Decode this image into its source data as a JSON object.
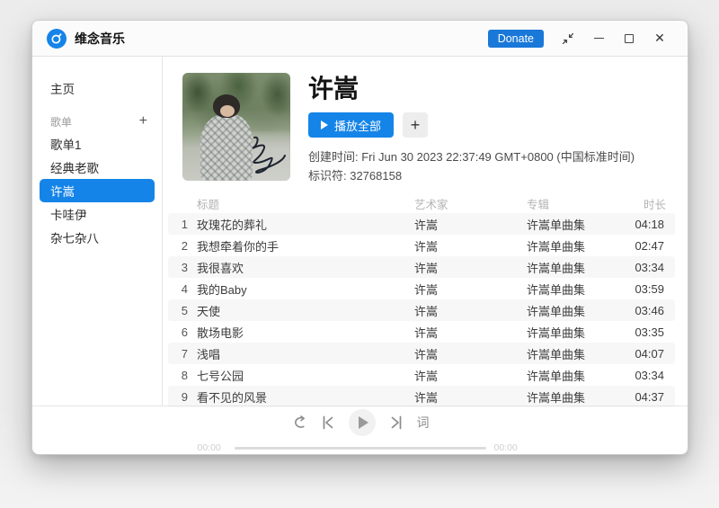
{
  "window": {
    "title": "维念音乐",
    "accent_color": "#1584e8",
    "titlebar": {
      "donate_label": "Donate",
      "close_glyph": "✕"
    }
  },
  "sidebar": {
    "home_label": "主页",
    "section_label": "歌单",
    "add_glyph": "+",
    "playlists": [
      "歌单1",
      "经典老歌",
      "许嵩",
      "卡哇伊",
      "杂七杂八"
    ],
    "selected_index": 2
  },
  "playlist_header": {
    "title": "许嵩",
    "play_all_label": "播放全部",
    "add_label": "+",
    "created_line": "创建时间: Fri Jun 30 2023 22:37:49 GMT+0800 (中国标准时间)",
    "id_line": "标识符: 32768158"
  },
  "track_table": {
    "columns": [
      "标题",
      "艺术家",
      "专辑",
      "时长"
    ],
    "rows": [
      {
        "num": "1",
        "title": "玫瑰花的葬礼",
        "artist": "许嵩",
        "album": "许嵩单曲集",
        "duration": "04:18"
      },
      {
        "num": "2",
        "title": "我想牵着你的手",
        "artist": "许嵩",
        "album": "许嵩单曲集",
        "duration": "02:47"
      },
      {
        "num": "3",
        "title": "我很喜欢",
        "artist": "许嵩",
        "album": "许嵩单曲集",
        "duration": "03:34"
      },
      {
        "num": "4",
        "title": "我的Baby",
        "artist": "许嵩",
        "album": "许嵩单曲集",
        "duration": "03:59"
      },
      {
        "num": "5",
        "title": "天使",
        "artist": "许嵩",
        "album": "许嵩单曲集",
        "duration": "03:46"
      },
      {
        "num": "6",
        "title": "散场电影",
        "artist": "许嵩",
        "album": "许嵩单曲集",
        "duration": "03:35"
      },
      {
        "num": "7",
        "title": "浅唱",
        "artist": "许嵩",
        "album": "许嵩单曲集",
        "duration": "04:07"
      },
      {
        "num": "8",
        "title": "七号公园",
        "artist": "许嵩",
        "album": "许嵩单曲集",
        "duration": "03:34"
      },
      {
        "num": "9",
        "title": "看不见的风景",
        "artist": "许嵩",
        "album": "许嵩单曲集",
        "duration": "04:37"
      }
    ]
  },
  "player": {
    "lyrics_label": "词",
    "current_time": "00:00",
    "total_time": "00:00"
  }
}
